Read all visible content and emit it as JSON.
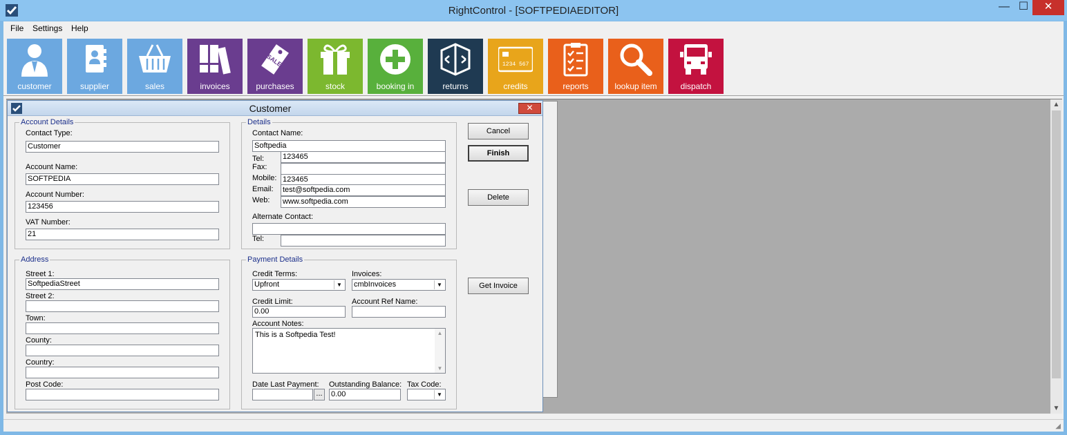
{
  "window": {
    "title": "RightControl - [SOFTPEDIAEDITOR]",
    "min": "—",
    "max": "☐",
    "close": "✕"
  },
  "menu": [
    {
      "label": "File"
    },
    {
      "label": "Settings"
    },
    {
      "label": "Help"
    }
  ],
  "toolbar": [
    {
      "label": "customer",
      "color": "#6ca8e0"
    },
    {
      "label": "supplier",
      "color": "#6ca8e0"
    },
    {
      "label": "sales",
      "color": "#6ca8e0"
    },
    {
      "label": "invoices",
      "color": "#6a3d8f"
    },
    {
      "label": "purchases",
      "color": "#6a3d8f"
    },
    {
      "label": "stock",
      "color": "#7cb82f"
    },
    {
      "label": "booking in",
      "color": "#58b03c"
    },
    {
      "label": "returns",
      "color": "#1f3a52"
    },
    {
      "label": "credits",
      "color": "#e8a51b"
    },
    {
      "label": "reports",
      "color": "#e9601b"
    },
    {
      "label": "lookup item",
      "color": "#e9601b"
    },
    {
      "label": "dispatch",
      "color": "#c3123f"
    }
  ],
  "icons": {
    "sale_tag_text": "SALE",
    "card_number": "1234 567"
  },
  "dialog": {
    "title": "Customer",
    "close": "✕",
    "account": {
      "legend": "Account Details",
      "contact_type_label": "Contact Type:",
      "contact_type": "Customer",
      "account_name_label": "Account Name:",
      "account_name": "SOFTPEDIA",
      "account_number_label": "Account Number:",
      "account_number": "123456",
      "vat_label": "VAT Number:",
      "vat": "21"
    },
    "details": {
      "legend": "Details",
      "contact_name_label": "Contact Name:",
      "contact_name": "Softpedia",
      "tel_label": "Tel:",
      "tel": "123465",
      "fax_label": "Fax:",
      "fax": "",
      "mobile_label": "Mobile:",
      "mobile": "123465",
      "email_label": "Email:",
      "email": "test@softpedia.com",
      "web_label": "Web:",
      "web": "www.softpedia.com",
      "alt_contact_label": "Alternate Contact:",
      "alt_contact": "",
      "alt_tel_label": "Tel:",
      "alt_tel": ""
    },
    "address": {
      "legend": "Address",
      "street1_label": "Street 1:",
      "street1": "SoftpediaStreet",
      "street2_label": "Street 2:",
      "street2": "",
      "town_label": "Town:",
      "town": "",
      "county_label": "County:",
      "county": "",
      "country_label": "Country:",
      "country": "",
      "postcode_label": "Post Code:",
      "postcode": ""
    },
    "payment": {
      "legend": "Payment Details",
      "credit_terms_label": "Credit Terms:",
      "credit_terms": "Upfront",
      "invoices_label": "Invoices:",
      "invoices": "cmbInvoices",
      "credit_limit_label": "Credit Limit:",
      "credit_limit": "0.00",
      "account_ref_label": "Account Ref Name:",
      "account_ref": "",
      "notes_label": "Account Notes:",
      "notes": "This is a Softpedia Test!",
      "date_last_payment_label": "Date Last Payment:",
      "date_last_payment": "",
      "ellipsis": "...",
      "outstanding_label": "Outstanding Balance:",
      "outstanding": "0.00",
      "tax_code_label": "Tax Code:",
      "tax_code": ""
    },
    "buttons": {
      "cancel": "Cancel",
      "finish": "Finish",
      "delete": "Delete",
      "get_invoice": "Get Invoice"
    }
  }
}
